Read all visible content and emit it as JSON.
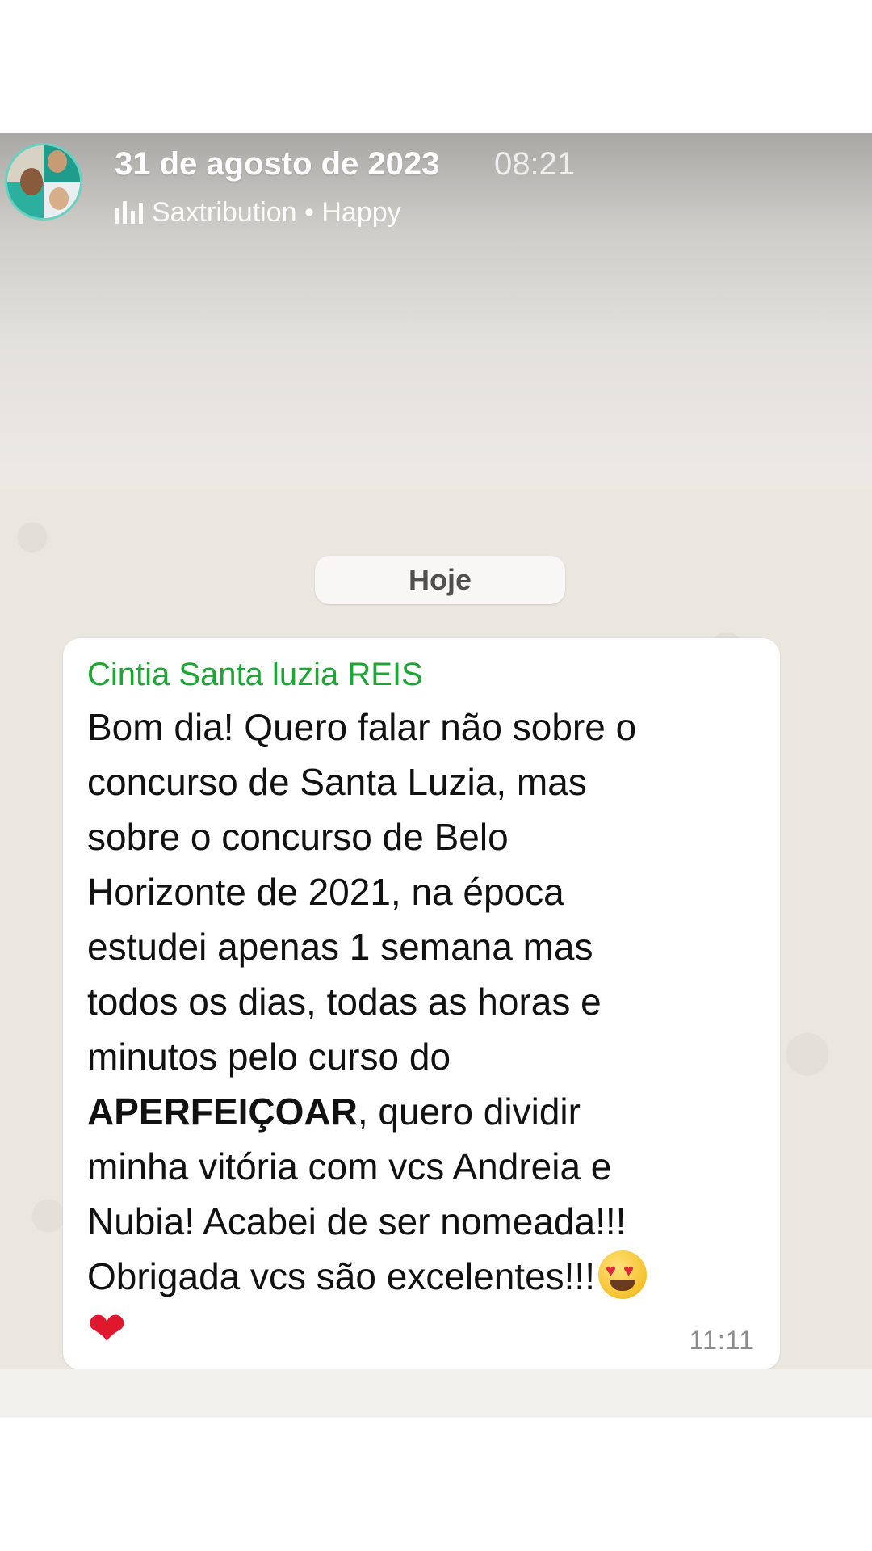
{
  "header": {
    "date": "31 de agosto de 2023",
    "time": "08:21",
    "music_icon": "music-bars-icon",
    "music": "Saxtribution • Happy"
  },
  "chat": {
    "day_label": "Hoje",
    "message": {
      "sender": "Cintia Santa luzia REIS",
      "sender_color": "#1fa535",
      "lines": [
        "Bom dia! Quero falar não sobre o",
        "concurso de Santa Luzia, mas",
        "sobre o concurso de Belo",
        "Horizonte de 2021, na época",
        "estudei apenas 1 semana mas",
        "todos os dias, todas as horas e",
        "minutos pelo curso do"
      ],
      "bold_word": "APERFEIÇOAR",
      "line_after_bold": ", quero dividir",
      "lines_2": [
        "minha vitória com vcs Andreia e",
        "Nubia! Acabei de ser nomeada!!!"
      ],
      "last_line": "Obrigada vcs são excelentes!!!",
      "emojis": [
        "smiling-face-with-heart-eyes",
        "red-heart"
      ],
      "heart_glyph": "❤",
      "eye_glyph": "♥",
      "time": "11:11"
    }
  }
}
